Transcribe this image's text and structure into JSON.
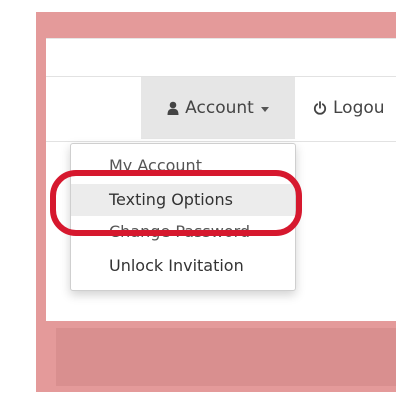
{
  "navbar": {
    "account_label": "Account",
    "logout_label": "Logou"
  },
  "icons": {
    "account": "user-icon",
    "account_caret": "caret-down-icon",
    "logout": "power-icon"
  },
  "dropdown": {
    "items": [
      {
        "label": "My Account"
      },
      {
        "label": "Texting Options",
        "selected": true
      },
      {
        "label": "Change Password"
      },
      {
        "label": "Unlock Invitation"
      }
    ]
  },
  "colors": {
    "frame": "#e49a9a",
    "annotation": "#d6182e",
    "active_nav_bg": "#e6e6e6"
  }
}
